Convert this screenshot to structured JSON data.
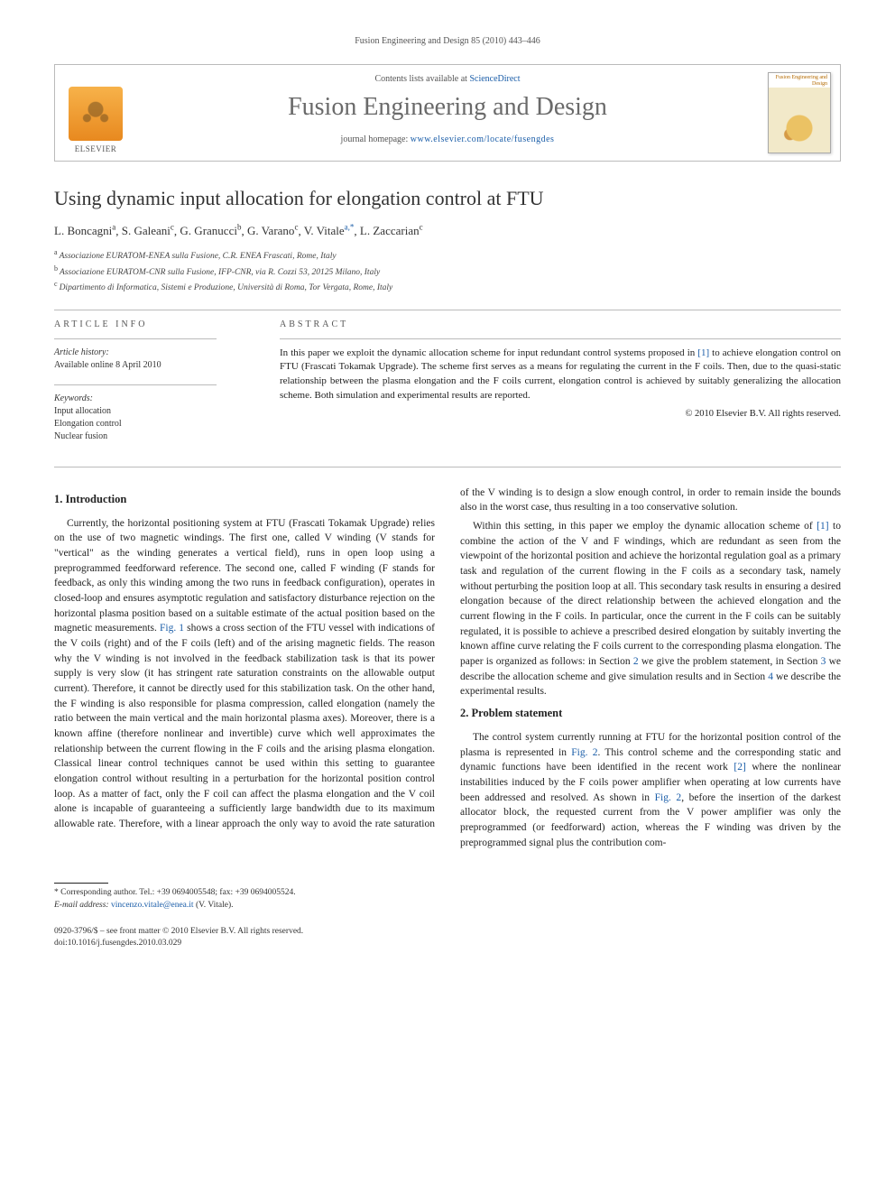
{
  "running_head": "Fusion Engineering and Design 85 (2010) 443–446",
  "masthead": {
    "contents_prefix": "Contents lists available at ",
    "contents_link": "ScienceDirect",
    "journal_title": "Fusion Engineering and Design",
    "homepage_prefix": "journal homepage: ",
    "homepage_url": "www.elsevier.com/locate/fusengdes",
    "publisher": "ELSEVIER",
    "cover_label": "Fusion Engineering and Design"
  },
  "article": {
    "title": "Using dynamic input allocation for elongation control at FTU",
    "authors_html": [
      {
        "name": "L. Boncagni",
        "sup": "a"
      },
      {
        "name": "S. Galeani",
        "sup": "c"
      },
      {
        "name": "G. Granucci",
        "sup": "b"
      },
      {
        "name": "G. Varano",
        "sup": "c"
      },
      {
        "name": "V. Vitale",
        "sup": "a,*",
        "corr": true
      },
      {
        "name": "L. Zaccarian",
        "sup": "c"
      }
    ],
    "affiliations": [
      {
        "sup": "a",
        "text": "Associazione EURATOM-ENEA sulla Fusione, C.R. ENEA Frascati, Rome, Italy"
      },
      {
        "sup": "b",
        "text": "Associazione EURATOM-CNR sulla Fusione, IFP-CNR, via R. Cozzi 53, 20125 Milano, Italy"
      },
      {
        "sup": "c",
        "text": "Dipartimento di Informatica, Sistemi e Produzione, Università di Roma, Tor Vergata, Rome, Italy"
      }
    ]
  },
  "article_info": {
    "head": "article info",
    "history_label": "Article history:",
    "history_line": "Available online 8 April 2010",
    "keywords_label": "Keywords:",
    "keywords": [
      "Input allocation",
      "Elongation control",
      "Nuclear fusion"
    ]
  },
  "abstract": {
    "head": "abstract",
    "text_pre": "In this paper we exploit the dynamic allocation scheme for input redundant control systems proposed in ",
    "ref": "[1]",
    "text_post": " to achieve elongation control on FTU (Frascati Tokamak Upgrade). The scheme first serves as a means for regulating the current in the F coils. Then, due to the quasi-static relationship between the plasma elongation and the F coils current, elongation control is achieved by suitably generalizing the allocation scheme. Both simulation and experimental results are reported.",
    "copyright": "© 2010 Elsevier B.V. All rights reserved."
  },
  "sections": {
    "s1_head": "1.  Introduction",
    "s1_p1_a": "Currently, the horizontal positioning system at FTU (Frascati Tokamak Upgrade) relies on the use of two magnetic windings. The first one, called V winding (V stands for \"vertical\" as the winding generates a vertical field), runs in open loop using a preprogrammed feedforward reference. The second one, called F winding (F stands for feedback, as only this winding among the two runs in feedback configuration), operates in closed-loop and ensures asymptotic regulation and satisfactory disturbance rejection on the horizontal plasma position based on a suitable estimate of the actual position based on the magnetic measurements. ",
    "s1_p1_fig": "Fig. 1",
    "s1_p1_b": " shows a cross section of the FTU vessel with indications of the V coils (right) and of the F coils (left) and of the arising magnetic fields. The reason why the V winding is not involved in the feedback stabilization task is that its power supply is very slow (it has stringent rate saturation constraints on the allowable output current). Therefore, it cannot be directly used for this stabilization task. On the other hand, the F winding is also responsible for plasma compression, called elongation (namely the ratio between the main vertical and the main horizontal plasma axes). Moreover, there is a known affine (therefore nonlinear and invertible) curve which well approximates the relationship between the current flowing in the F coils and the arising plasma elongation. Classical linear control techniques cannot be used within this setting to guarantee elongation control without resulting in a perturbation for the horizontal position control loop. As a matter of fact, only the F coil can affect the plasma elongation and the V coil alone is incapable of guaranteeing a sufficiently large bandwidth due to its maximum allowable rate. Therefore, with a linear approach the only way to avoid the rate saturation of the V winding is to design a slow enough control, in order to remain inside the bounds also in the worst case, thus resulting in a too conservative solution.",
    "s1_p2_a": "Within this setting, in this paper we employ the dynamic allocation scheme of ",
    "s1_p2_ref": "[1]",
    "s1_p2_b": " to combine the action of the V and F windings, which are redundant as seen from the viewpoint of the horizontal position and achieve the horizontal regulation goal as a primary task and regulation of the current flowing in the F coils as a secondary task, namely without perturbing the position loop at all. This secondary task results in ensuring a desired elongation because of the direct relationship between the achieved elongation and the current flowing in the F coils. In particular, once the current in the F coils can be suitably regulated, it is possible to achieve a prescribed desired elongation by suitably inverting the known affine curve relating the F coils current to the corresponding plasma elongation. The paper is organized as follows: in Section ",
    "s1_p2_sec2": "2",
    "s1_p2_c": " we give the problem statement, in Section ",
    "s1_p2_sec3": "3",
    "s1_p2_d": " we describe the allocation scheme and give simulation results and in Section ",
    "s1_p2_sec4": "4",
    "s1_p2_e": " we describe the experimental results.",
    "s2_head": "2.  Problem statement",
    "s2_p1_a": "The control system currently running at FTU for the horizontal position control of the plasma is represented in ",
    "s2_p1_fig2a": "Fig. 2",
    "s2_p1_b": ". This control scheme and the corresponding static and dynamic functions have been identified in the recent work ",
    "s2_p1_ref": "[2]",
    "s2_p1_c": " where the nonlinear instabilities induced by the F coils power amplifier when operating at low currents have been addressed and resolved. As shown in ",
    "s2_p1_fig2b": "Fig. 2",
    "s2_p1_d": ", before the insertion of the darkest allocator block, the requested current from the V power amplifier was only the preprogrammed (or feedforward) action, whereas the F winding was driven by the preprogrammed signal plus the contribution com-"
  },
  "footnotes": {
    "corr_label": "* Corresponding author. Tel.: +39 0694005548; fax: +39 0694005524.",
    "email_label": "E-mail address:",
    "email": "vincenzo.vitale@enea.it",
    "email_who": "(V. Vitale)."
  },
  "bottom": {
    "line1": "0920-3796/$ – see front matter © 2010 Elsevier B.V. All rights reserved.",
    "line2": "doi:10.1016/j.fusengdes.2010.03.029"
  }
}
